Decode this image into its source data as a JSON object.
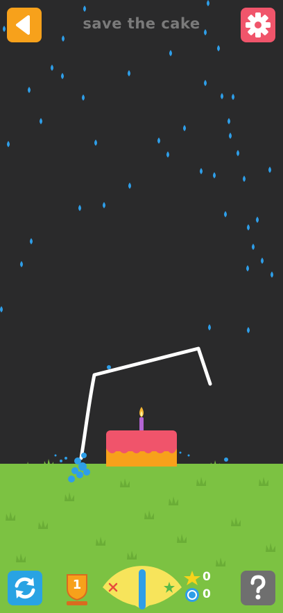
{
  "header": {
    "title": "save the cake",
    "back_icon": "triangle-left-icon",
    "settings_icon": "gear-icon"
  },
  "footer": {
    "level": "1",
    "stars": "0",
    "coins": "0",
    "restart_icon": "refresh-icon",
    "help_icon": "question-mark-icon",
    "meter_level": 0.5
  },
  "colors": {
    "background": "#2a2a2b",
    "grass": "#7cc242",
    "water": "#2e9ee8",
    "cake_top": "#f0546b",
    "cake_bottom": "#f7a11b",
    "back_button": "#f7a11b",
    "settings_button": "#f0556b",
    "restart_button": "#29a3e3",
    "help_button": "#6f6f6f",
    "meter": "#f7e45b"
  }
}
